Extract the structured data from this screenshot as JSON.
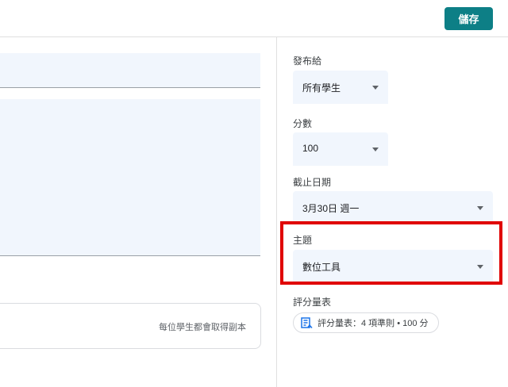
{
  "toolbar": {
    "save_label": "儲存"
  },
  "main": {
    "attachment_note": "每位學生都會取得副本"
  },
  "side": {
    "assign_to": {
      "label": "發布給",
      "value": "所有學生"
    },
    "points": {
      "label": "分數",
      "value": "100"
    },
    "due": {
      "label": "截止日期",
      "value": "3月30日 週一"
    },
    "topic": {
      "label": "主題",
      "value": "數位工具"
    },
    "rubric": {
      "label": "評分量表",
      "chip": "評分量表：4 項準則 • 100 分",
      "icon": "rubric-icon"
    }
  },
  "colors": {
    "accent": "#0d7f86",
    "field_bg": "#f1f6fd",
    "highlight": "#e00000"
  }
}
